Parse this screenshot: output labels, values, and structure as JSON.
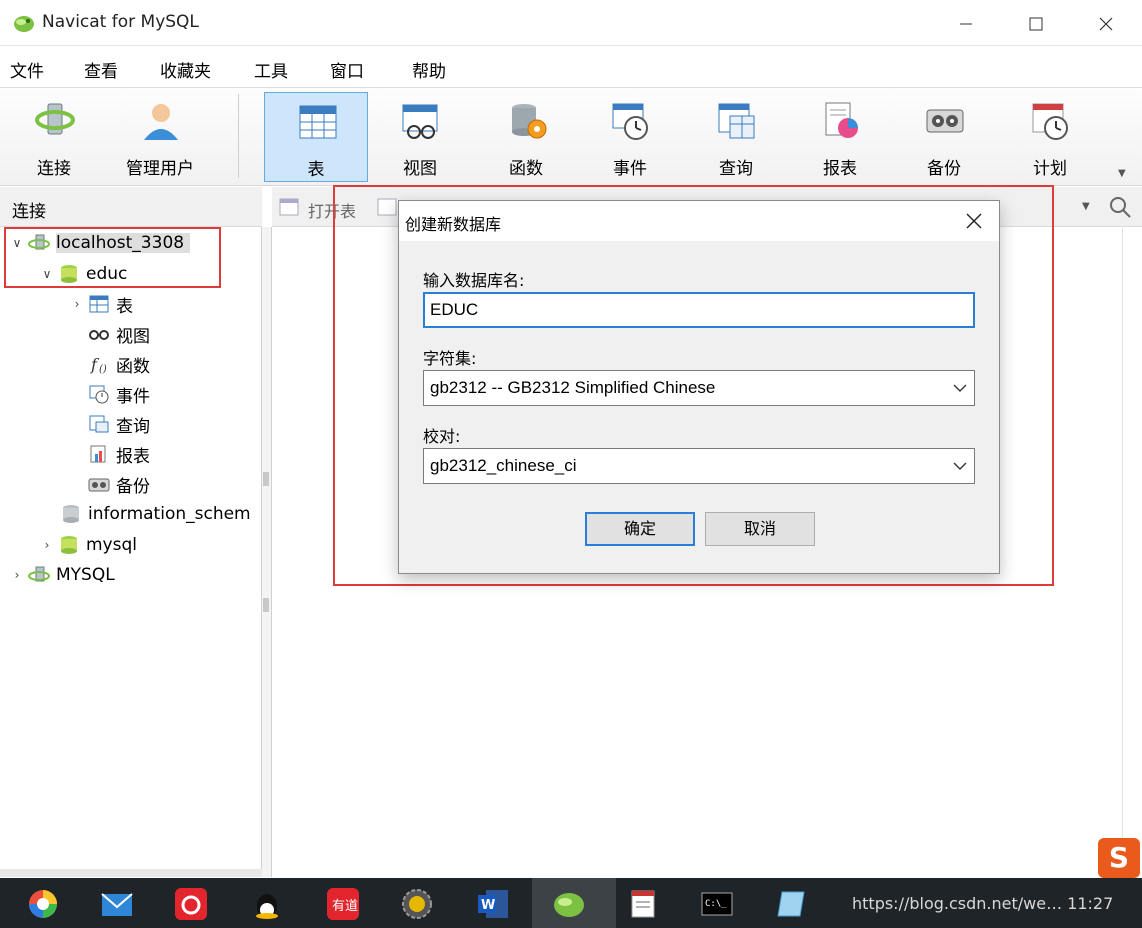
{
  "window": {
    "title": "Navicat for MySQL"
  },
  "menu": [
    "文件",
    "查看",
    "收藏夹",
    "工具",
    "窗口",
    "帮助"
  ],
  "toolbar": {
    "connect": "连接",
    "manage_users": "管理用户",
    "buttons": [
      "表",
      "视图",
      "函数",
      "事件",
      "查询",
      "报表",
      "备份",
      "计划"
    ],
    "active": "表"
  },
  "left_panel": {
    "header": "连接",
    "tree": {
      "connection": "localhost_3308",
      "database": "educ",
      "children": [
        "表",
        "视图",
        "函数",
        "事件",
        "查询",
        "报表",
        "备份"
      ],
      "other_dbs": [
        "information_schem",
        "mysql"
      ],
      "other_connection": "MYSQL"
    }
  },
  "object_bar": {
    "open_table": "打开表"
  },
  "dialog": {
    "title": "创建新数据库",
    "name_label": "输入数据库名:",
    "name_value": "EDUC",
    "charset_label": "字符集:",
    "charset_value": "gb2312 -- GB2312 Simplified Chinese",
    "collation_label": "校对:",
    "collation_value": "gb2312_chinese_ci",
    "ok_label": "确定",
    "cancel_label": "取消"
  },
  "taskbar": {
    "watermark": "https://blog.csdn.net/we… 11:27"
  },
  "colors": {
    "highlight_red": "#e03b3b",
    "accent_blue": "#2a7fd4",
    "sogou_orange": "#ea5a1c"
  }
}
